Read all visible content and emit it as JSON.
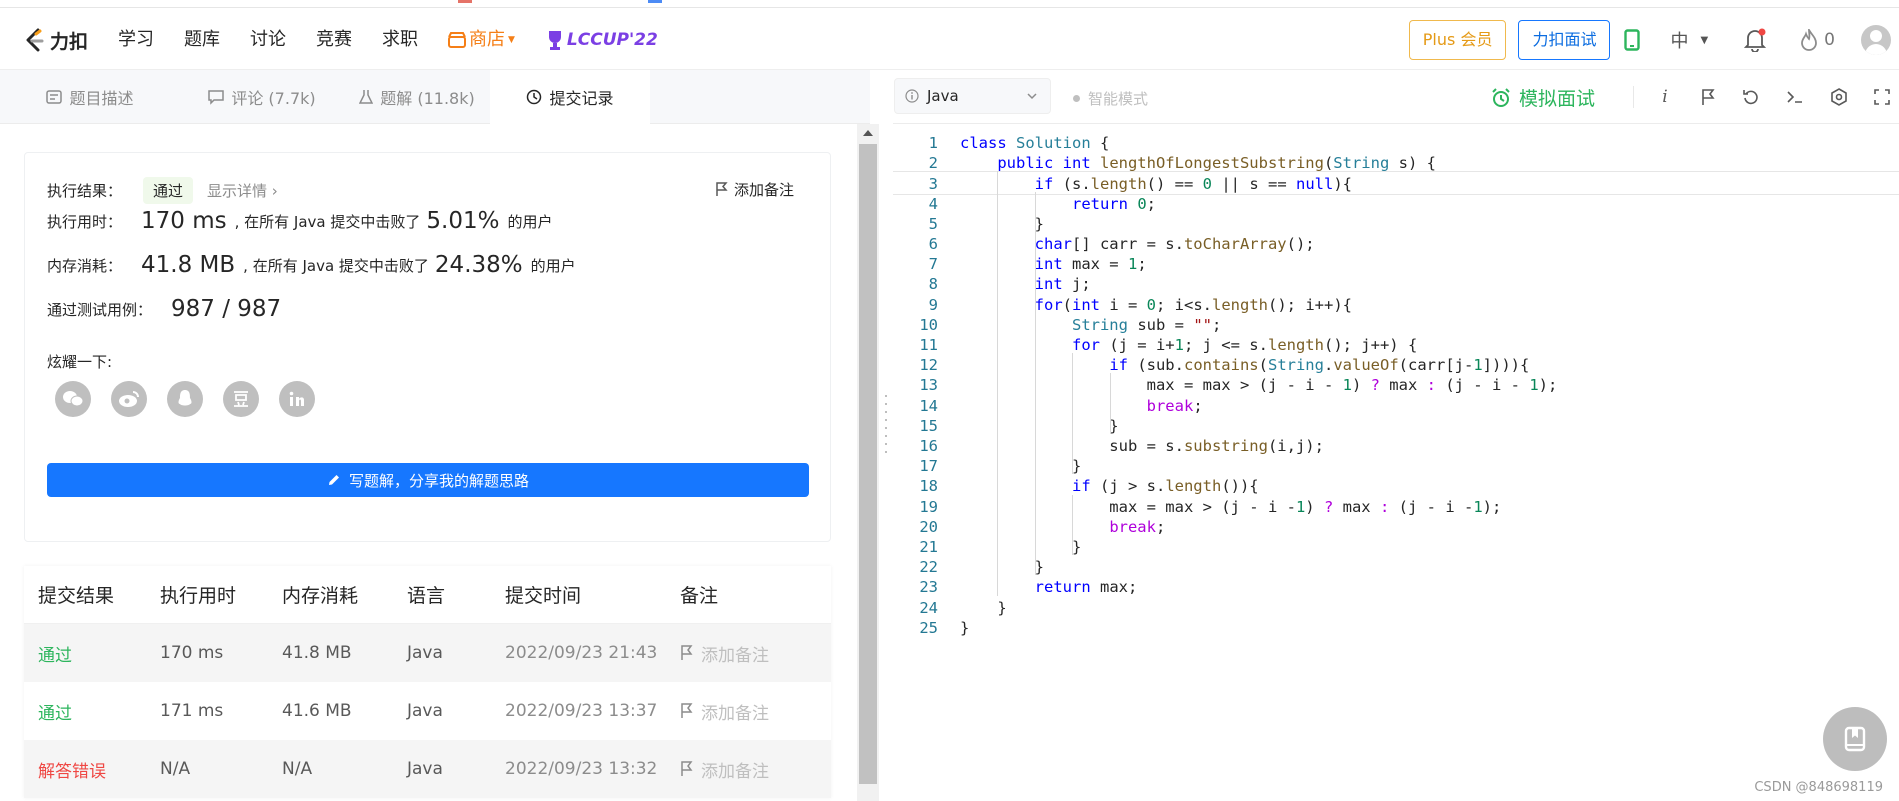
{
  "header": {
    "logo_text": "力扣",
    "nav": [
      "学习",
      "题库",
      "讨论",
      "竞赛",
      "求职"
    ],
    "store_label": "商店",
    "lccup_label": "LCCUP'22",
    "plus_label": "Plus 会员",
    "interview_label": "力扣面试",
    "lang_label": "中",
    "streak_count": "0",
    "colors": {
      "brand_orange": "#f57f17",
      "plus_gold": "#e59a16",
      "interview_blue": "#0b6ce0",
      "lccup_purple": "#7b3fe4"
    }
  },
  "tabs": [
    {
      "label": "题目描述",
      "icon": "description-icon"
    },
    {
      "label": "评论 (7.7k)",
      "icon": "comment-icon"
    },
    {
      "label": "题解 (11.8k)",
      "icon": "flask-icon"
    },
    {
      "label": "提交记录",
      "icon": "clock-icon",
      "active": true
    }
  ],
  "result": {
    "status_label": "执行结果：",
    "status_value": "通过",
    "detail_link": "显示详情 ›",
    "add_note": "添加备注",
    "time_label": "执行用时：",
    "time_value": "170 ms",
    "time_text": ", 在所有 Java 提交中击败了",
    "time_pct": "5.01%",
    "users_text": "的用户",
    "mem_label": "内存消耗：",
    "mem_value": "41.8 MB",
    "mem_text": ", 在所有 Java 提交中击败了",
    "mem_pct": "24.38%",
    "cases_label": "通过测试用例：",
    "cases_value": "987 / 987",
    "share_label": "炫耀一下:",
    "share_icons": [
      "wechat-icon",
      "weibo-icon",
      "qq-icon",
      "douban-icon",
      "linkedin-icon"
    ],
    "write_button": "写题解，分享我的解题思路"
  },
  "submissions": {
    "headers": [
      "提交结果",
      "执行用时",
      "内存消耗",
      "语言",
      "提交时间",
      "备注"
    ],
    "rows": [
      {
        "status": "通过",
        "ok": true,
        "time": "170 ms",
        "memory": "41.8 MB",
        "lang": "Java",
        "submitted": "2022/09/23 21:43",
        "note": "添加备注"
      },
      {
        "status": "通过",
        "ok": true,
        "time": "171 ms",
        "memory": "41.6 MB",
        "lang": "Java",
        "submitted": "2022/09/23 13:37",
        "note": "添加备注"
      },
      {
        "status": "解答错误",
        "ok": false,
        "time": "N/A",
        "memory": "N/A",
        "lang": "Java",
        "submitted": "2022/09/23 13:32",
        "note": "添加备注"
      }
    ]
  },
  "editor": {
    "language": "Java",
    "smart_mode": "智能模式",
    "mock_interview": "模拟面试",
    "current_line": 3,
    "lines": [
      [
        {
          "t": "class ",
          "c": "kw"
        },
        {
          "t": "Solution",
          "c": "ty"
        },
        {
          "t": " {"
        }
      ],
      [
        {
          "t": "    "
        },
        {
          "t": "public ",
          "c": "kw"
        },
        {
          "t": "int ",
          "c": "kw"
        },
        {
          "t": "lengthOfLongestSubstring",
          "c": "fn"
        },
        {
          "t": "("
        },
        {
          "t": "String",
          "c": "ty"
        },
        {
          "t": " s) {"
        }
      ],
      [
        {
          "t": "        "
        },
        {
          "t": "if",
          "c": "kw"
        },
        {
          "t": " (s."
        },
        {
          "t": "length",
          "c": "fn"
        },
        {
          "t": "() == "
        },
        {
          "t": "0",
          "c": "nu"
        },
        {
          "t": " || s == "
        },
        {
          "t": "null",
          "c": "kw"
        },
        {
          "t": "){"
        }
      ],
      [
        {
          "t": "            "
        },
        {
          "t": "return ",
          "c": "kw"
        },
        {
          "t": "0",
          "c": "nu"
        },
        {
          "t": ";"
        }
      ],
      [
        {
          "t": "        }"
        }
      ],
      [
        {
          "t": "        "
        },
        {
          "t": "char",
          "c": "kw"
        },
        {
          "t": "[] carr = s."
        },
        {
          "t": "toCharArray",
          "c": "fn"
        },
        {
          "t": "();"
        }
      ],
      [
        {
          "t": "        "
        },
        {
          "t": "int ",
          "c": "kw"
        },
        {
          "t": "max = "
        },
        {
          "t": "1",
          "c": "nu"
        },
        {
          "t": ";"
        }
      ],
      [
        {
          "t": "        "
        },
        {
          "t": "int ",
          "c": "kw"
        },
        {
          "t": "j;"
        }
      ],
      [
        {
          "t": "        "
        },
        {
          "t": "for",
          "c": "kw"
        },
        {
          "t": "("
        },
        {
          "t": "int ",
          "c": "kw"
        },
        {
          "t": "i = "
        },
        {
          "t": "0",
          "c": "nu"
        },
        {
          "t": "; i<s."
        },
        {
          "t": "length",
          "c": "fn"
        },
        {
          "t": "(); i++){"
        }
      ],
      [
        {
          "t": "            "
        },
        {
          "t": "String",
          "c": "ty"
        },
        {
          "t": " sub = "
        },
        {
          "t": "\"\"",
          "c": "st"
        },
        {
          "t": ";"
        }
      ],
      [
        {
          "t": "            "
        },
        {
          "t": "for",
          "c": "kw"
        },
        {
          "t": " (j = i+"
        },
        {
          "t": "1",
          "c": "nu"
        },
        {
          "t": "; j <= s."
        },
        {
          "t": "length",
          "c": "fn"
        },
        {
          "t": "(); j++) {"
        }
      ],
      [
        {
          "t": "                "
        },
        {
          "t": "if",
          "c": "kw"
        },
        {
          "t": " (sub."
        },
        {
          "t": "contains",
          "c": "fn"
        },
        {
          "t": "("
        },
        {
          "t": "String",
          "c": "ty"
        },
        {
          "t": "."
        },
        {
          "t": "valueOf",
          "c": "fn"
        },
        {
          "t": "(carr[j-"
        },
        {
          "t": "1",
          "c": "nu"
        },
        {
          "t": "]))){"
        }
      ],
      [
        {
          "t": "                    max = max > (j - i - "
        },
        {
          "t": "1",
          "c": "nu"
        },
        {
          "t": ") "
        },
        {
          "t": "?",
          "c": "op"
        },
        {
          "t": " max "
        },
        {
          "t": ":",
          "c": "op"
        },
        {
          "t": " (j - i - "
        },
        {
          "t": "1",
          "c": "nu"
        },
        {
          "t": ");"
        }
      ],
      [
        {
          "t": "                    "
        },
        {
          "t": "break",
          "c": "op"
        },
        {
          "t": ";"
        }
      ],
      [
        {
          "t": "                }"
        }
      ],
      [
        {
          "t": "                sub = s."
        },
        {
          "t": "substring",
          "c": "fn"
        },
        {
          "t": "(i,j);"
        }
      ],
      [
        {
          "t": "            }"
        }
      ],
      [
        {
          "t": "            "
        },
        {
          "t": "if",
          "c": "kw"
        },
        {
          "t": " (j > s."
        },
        {
          "t": "length",
          "c": "fn"
        },
        {
          "t": "()){"
        }
      ],
      [
        {
          "t": "                max = max > (j - i -"
        },
        {
          "t": "1",
          "c": "nu"
        },
        {
          "t": ") "
        },
        {
          "t": "?",
          "c": "op"
        },
        {
          "t": " max "
        },
        {
          "t": ":",
          "c": "op"
        },
        {
          "t": " (j - i -"
        },
        {
          "t": "1",
          "c": "nu"
        },
        {
          "t": ");"
        }
      ],
      [
        {
          "t": "                "
        },
        {
          "t": "break",
          "c": "op"
        },
        {
          "t": ";"
        }
      ],
      [
        {
          "t": "            }"
        }
      ],
      [
        {
          "t": "        }"
        }
      ],
      [
        {
          "t": "        "
        },
        {
          "t": "return ",
          "c": "kw"
        },
        {
          "t": "max;"
        }
      ],
      [
        {
          "t": "    }"
        }
      ],
      [
        {
          "t": "}"
        }
      ]
    ]
  },
  "watermark": "CSDN @848698119"
}
